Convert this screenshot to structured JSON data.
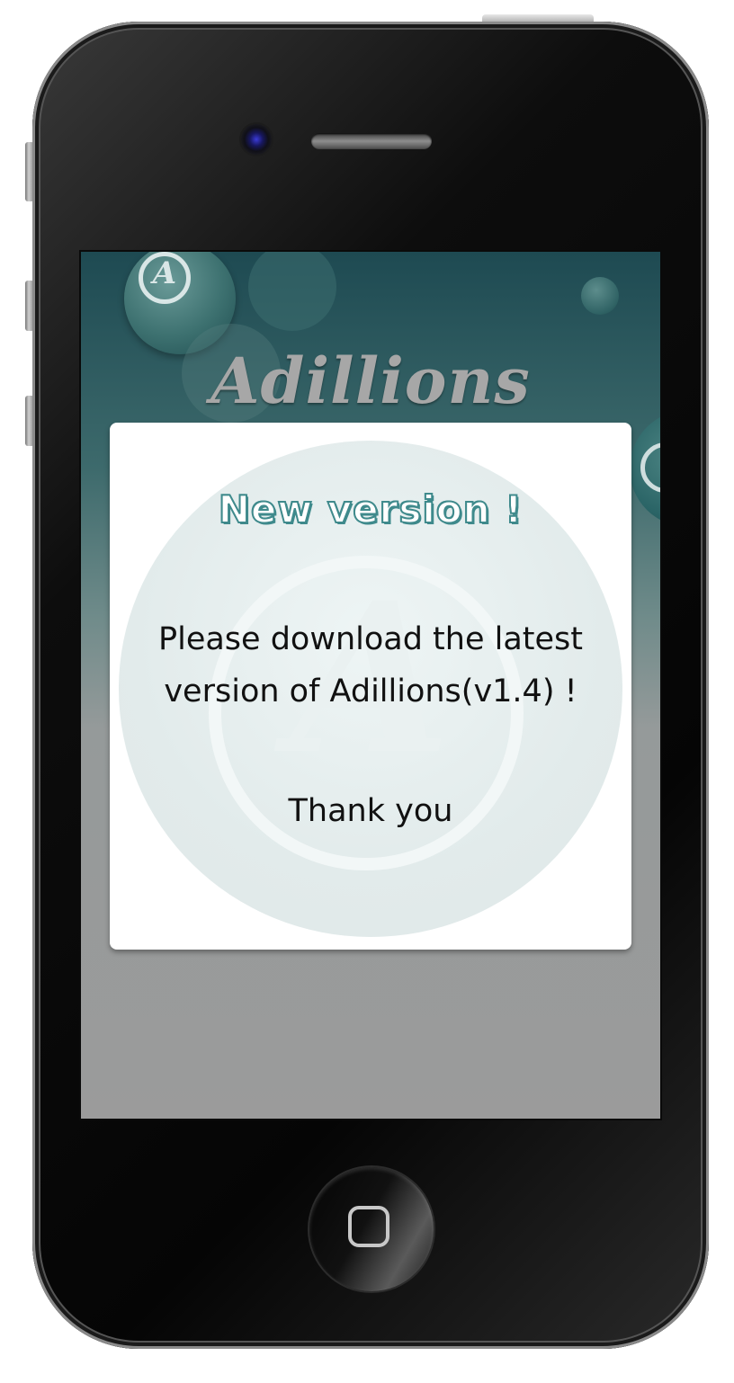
{
  "app": {
    "name": "Adillions"
  },
  "dialog": {
    "title": "New version !",
    "message": "Please download the latest version of Adillions(v1.4) !",
    "thanks": "Thank you"
  },
  "icons": {
    "home": "home-square-icon",
    "camera": "camera-icon",
    "speaker": "speaker-icon"
  },
  "colors": {
    "title_outline": "#3f8a8c",
    "screen_top": "#1e4a52",
    "screen_bottom": "#9b9b9b"
  }
}
